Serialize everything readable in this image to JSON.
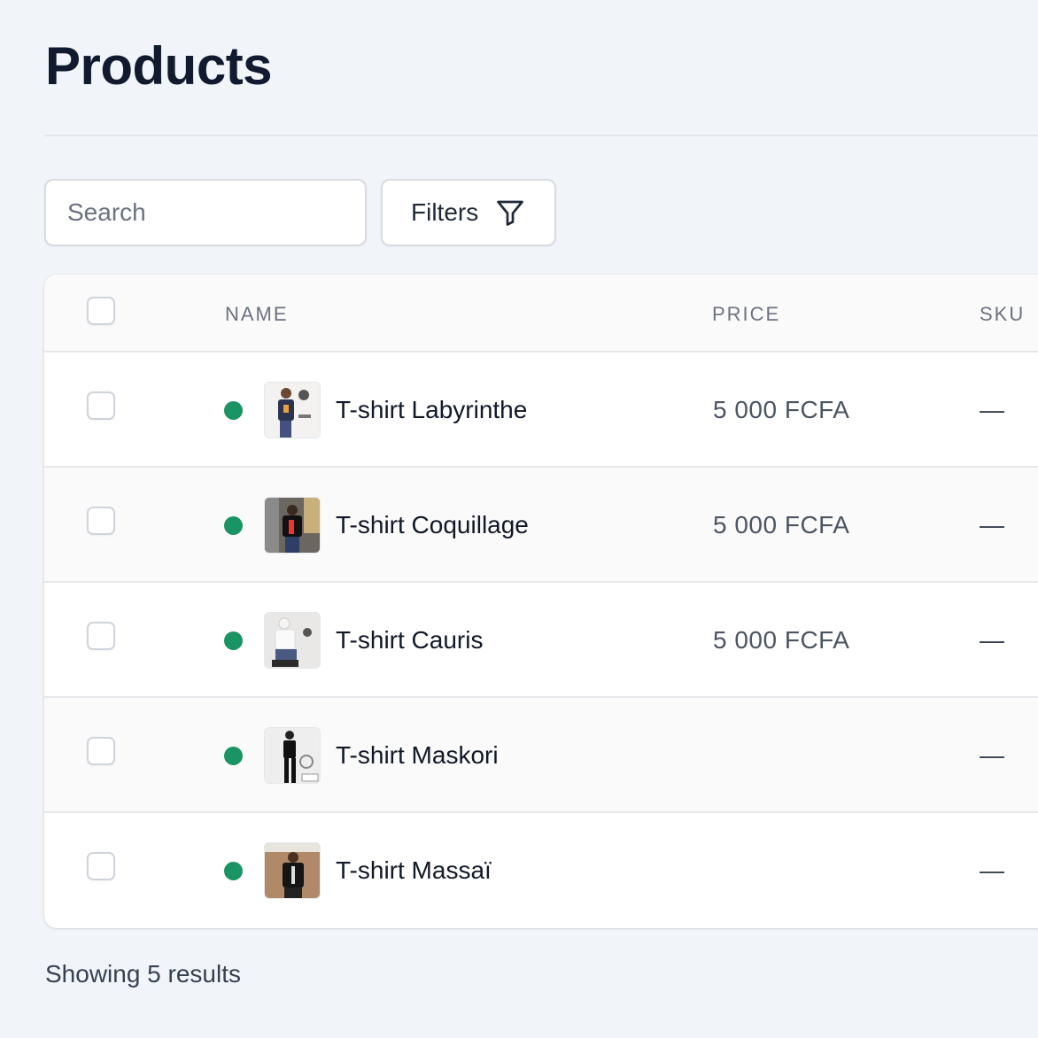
{
  "page": {
    "title": "Products"
  },
  "search": {
    "placeholder": "Search"
  },
  "filters": {
    "label": "Filters"
  },
  "table": {
    "columns": {
      "name": "NAME",
      "price": "PRICE",
      "sku": "SKU"
    },
    "rows": [
      {
        "name": "T-shirt Labyrinthe",
        "price": "5 000 FCFA",
        "sku": "—",
        "status_color": "#1a9463"
      },
      {
        "name": "T-shirt Coquillage",
        "price": "5 000 FCFA",
        "sku": "—",
        "status_color": "#1a9463"
      },
      {
        "name": "T-shirt Cauris",
        "price": "5 000 FCFA",
        "sku": "—",
        "status_color": "#1a9463"
      },
      {
        "name": "T-shirt Maskori",
        "price": "",
        "sku": "—",
        "status_color": "#1a9463"
      },
      {
        "name": "T-shirt Massaï",
        "price": "",
        "sku": "—",
        "status_color": "#1a9463"
      }
    ]
  },
  "footer": {
    "results": "Showing 5 results"
  },
  "icons": {
    "filters": "funnel-icon",
    "status": "status-dot"
  }
}
